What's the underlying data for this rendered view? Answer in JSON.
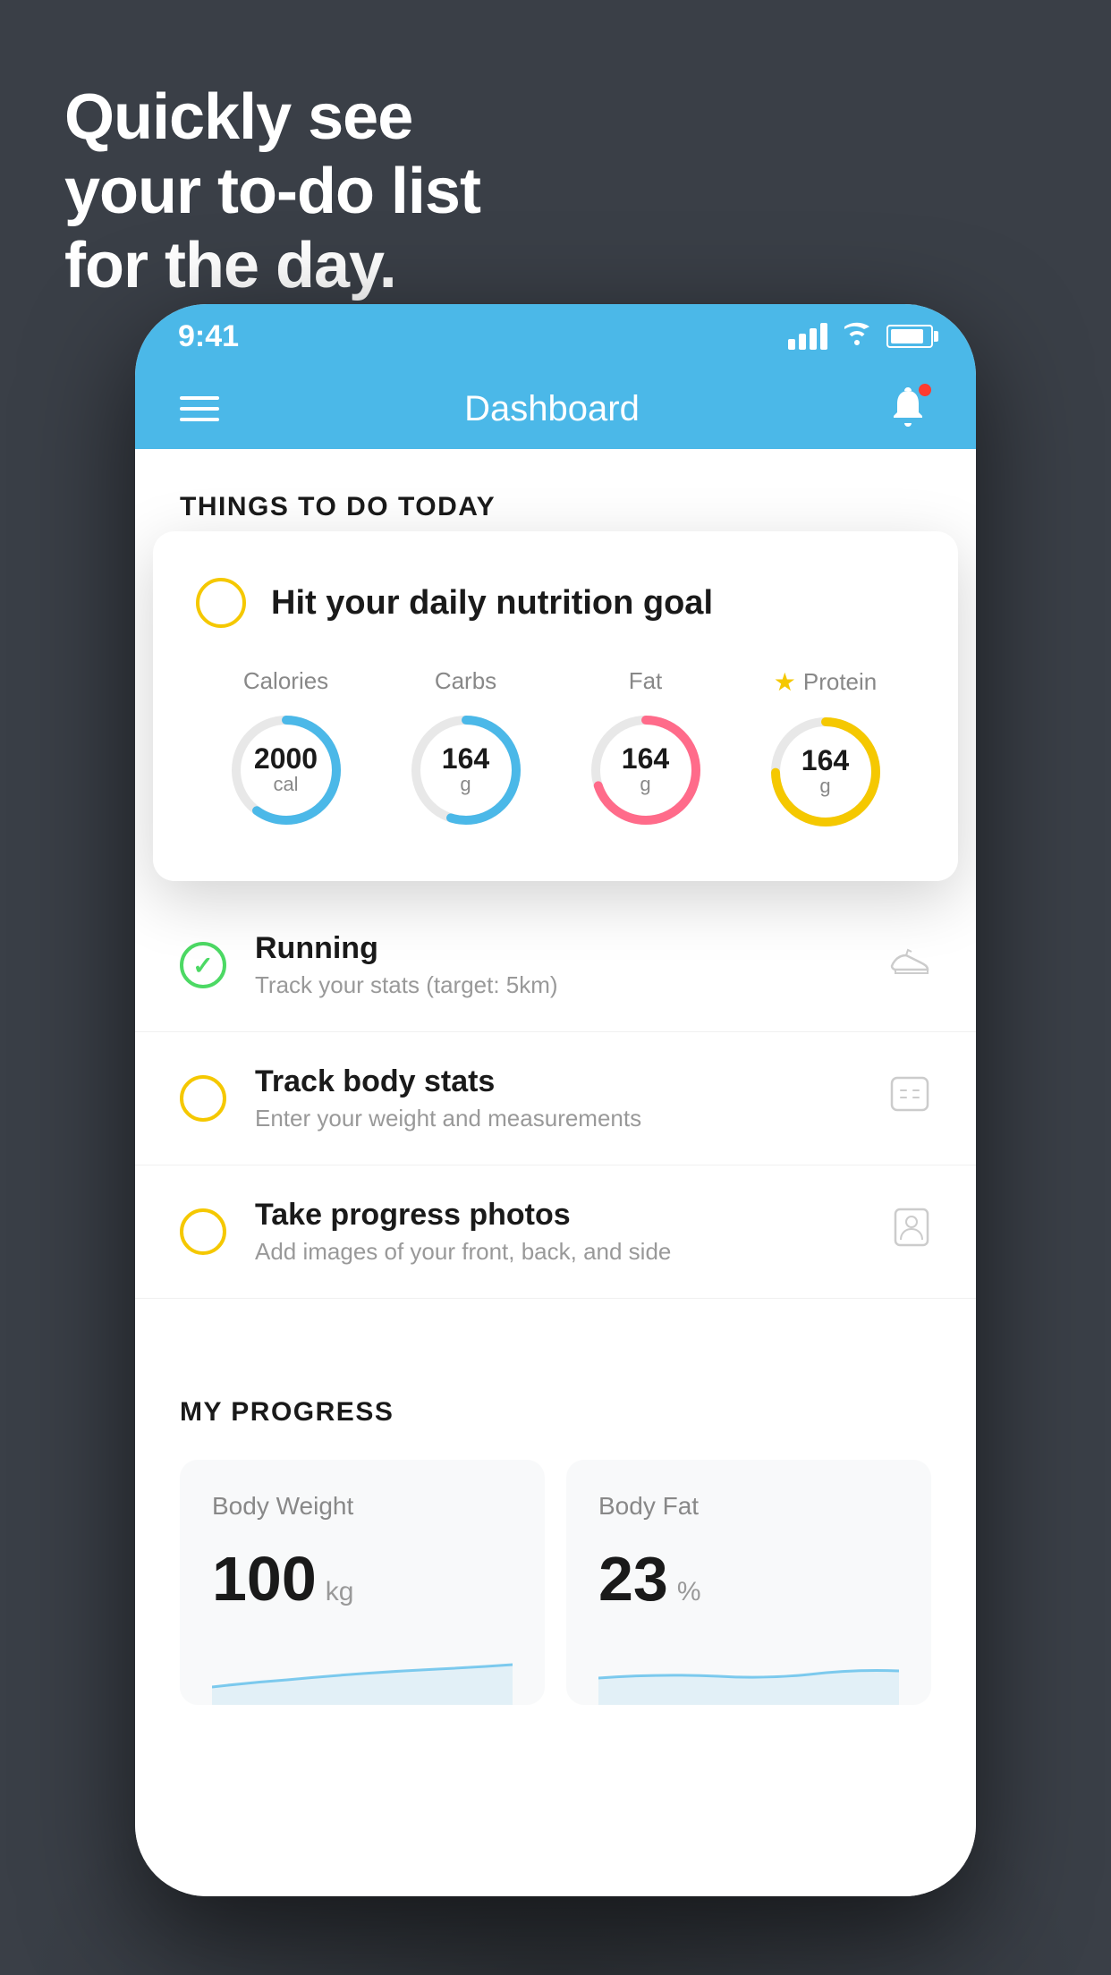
{
  "background_color": "#3a3f47",
  "hero": {
    "line1": "Quickly see",
    "line2": "your to-do list",
    "line3": "for the day."
  },
  "phone": {
    "status_bar": {
      "time": "9:41",
      "signal_bars": 4,
      "battery_percent": 85
    },
    "nav": {
      "title": "Dashboard",
      "hamburger_label": "Menu",
      "notification_label": "Notifications"
    },
    "section_header": {
      "title": "THINGS TO DO TODAY"
    },
    "floating_card": {
      "checkbox_color": "#f5c800",
      "title": "Hit your daily nutrition goal",
      "nutrition": [
        {
          "label": "Calories",
          "value": "2000",
          "unit": "cal",
          "color": "#4bb8e8",
          "percent": 60
        },
        {
          "label": "Carbs",
          "value": "164",
          "unit": "g",
          "color": "#4bb8e8",
          "percent": 55
        },
        {
          "label": "Fat",
          "value": "164",
          "unit": "g",
          "color": "#ff6b8a",
          "percent": 70
        },
        {
          "label": "Protein",
          "value": "164",
          "unit": "g",
          "color": "#f5c800",
          "percent": 75,
          "starred": true
        }
      ]
    },
    "todo_items": [
      {
        "id": "running",
        "title": "Running",
        "subtitle": "Track your stats (target: 5km)",
        "circle_color": "green",
        "checked": true,
        "icon": "shoe"
      },
      {
        "id": "body-stats",
        "title": "Track body stats",
        "subtitle": "Enter your weight and measurements",
        "circle_color": "yellow",
        "checked": false,
        "icon": "scale"
      },
      {
        "id": "progress-photos",
        "title": "Take progress photos",
        "subtitle": "Add images of your front, back, and side",
        "circle_color": "yellow",
        "checked": false,
        "icon": "person"
      }
    ],
    "progress_section": {
      "title": "MY PROGRESS",
      "cards": [
        {
          "id": "body-weight",
          "title": "Body Weight",
          "value": "100",
          "unit": "kg"
        },
        {
          "id": "body-fat",
          "title": "Body Fat",
          "value": "23",
          "unit": "%"
        }
      ]
    }
  }
}
